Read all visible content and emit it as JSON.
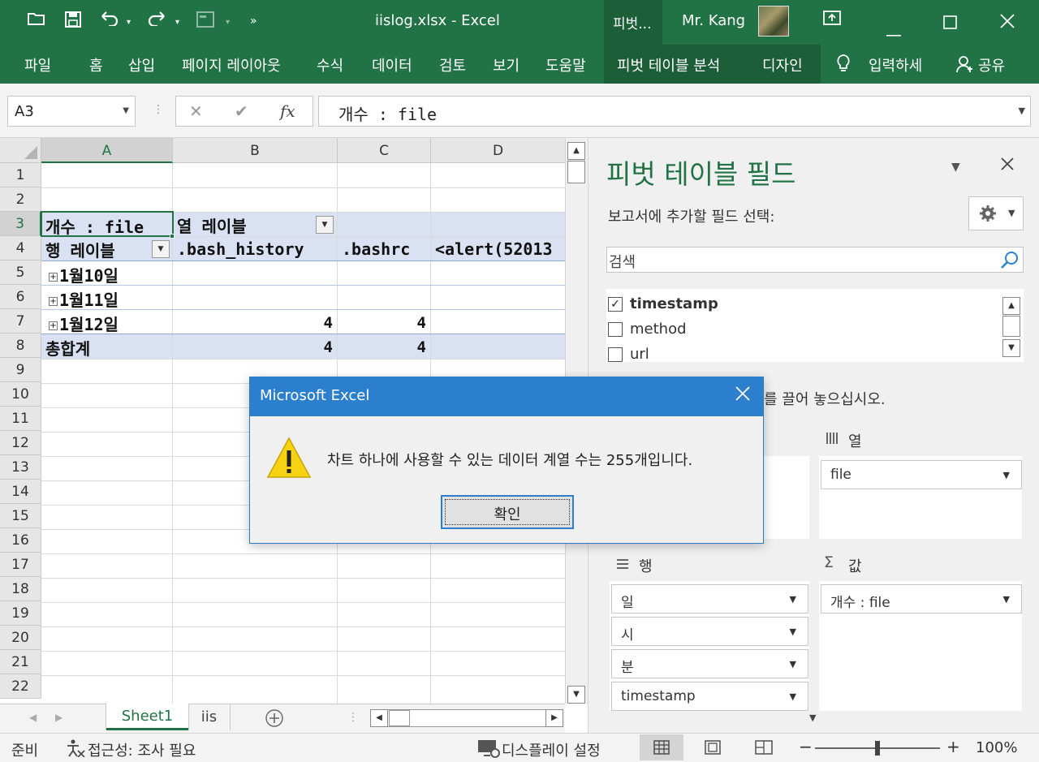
{
  "titlebar": {
    "filename": "iislog.xlsx  -  Excel",
    "context_tab": "피벗...",
    "user": "Mr. Kang"
  },
  "ribbon": {
    "tabs": [
      "파일",
      "홈",
      "삽입",
      "페이지 레이아웃",
      "수식",
      "데이터",
      "검토",
      "보기",
      "도움말",
      "피벗 테이블 분석",
      "디자인"
    ],
    "tell_me": "입력하세",
    "share": "공유"
  },
  "formula_bar": {
    "name_box": "A3",
    "fx": "fx",
    "content": "개수 : file"
  },
  "grid": {
    "columns": [
      "A",
      "B",
      "C",
      "D"
    ],
    "rows": [
      "1",
      "2",
      "3",
      "4",
      "5",
      "6",
      "7",
      "8",
      "9",
      "10",
      "11",
      "12",
      "13",
      "14",
      "15",
      "16",
      "17",
      "18",
      "19",
      "20",
      "21",
      "22"
    ],
    "a3": "개수 : file",
    "b3": "열 레이블",
    "a4": "행 레이블",
    "b4": ".bash_history",
    "c4": ".bashrc",
    "d4": "<alert(52013",
    "a5": "1월10일",
    "a6": "1월11일",
    "a7": "1월12일",
    "b7": "4",
    "c7": "4",
    "a8": "총합계",
    "b8": "4",
    "c8": "4"
  },
  "sheets": {
    "active": "Sheet1",
    "other": "iis"
  },
  "status": {
    "ready": "준비",
    "accessibility": "접근성: 조사 필요",
    "display": "디스플레이 설정",
    "zoom": "100%"
  },
  "pivot_pane": {
    "title": "피벗 테이블 필드",
    "subtitle": "보고서에 추가할 필드 선택:",
    "search_placeholder": "검색",
    "fields": [
      {
        "name": "timestamp",
        "checked": true
      },
      {
        "name": "method",
        "checked": false
      },
      {
        "name": "url",
        "checked": false
      }
    ],
    "drag_hint": "를 끌어 놓으십시오.",
    "columns_label": "열",
    "columns_items": [
      "file"
    ],
    "rows_label": "행",
    "rows_items": [
      "일",
      "시",
      "분",
      "timestamp"
    ],
    "values_label": "값",
    "values_items": [
      "개수 : file"
    ]
  },
  "dialog": {
    "title": "Microsoft Excel",
    "message": "차트 하나에 사용할 수 있는 데이터 계열 수는 255개입니다.",
    "ok": "확인"
  },
  "colors": {
    "excel_green": "#217346",
    "context_green": "#1b5e38",
    "pivot_band": "#d9e1f2",
    "dialog_blue": "#2b7fcc",
    "warning_yellow": "#f5d312"
  }
}
